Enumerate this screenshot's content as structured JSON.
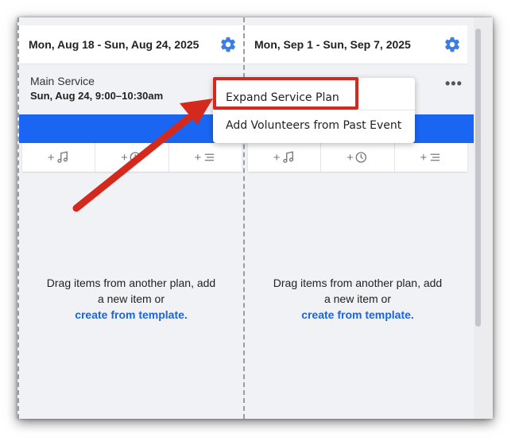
{
  "weeks": [
    {
      "header": "Mon, Aug 18 - Sun, Aug 24, 2025",
      "plan": {
        "name": "Main Service",
        "time": "Sun, Aug 24, 9:00–10:30am"
      },
      "empty": {
        "line1": "Drag items from another plan, add",
        "line2": "a new item or",
        "link": "create from template."
      }
    },
    {
      "header": "Mon, Sep 1 - Sun, Sep 7, 2025",
      "empty": {
        "line1": "Drag items from another plan, add",
        "line2": "a new item or",
        "link": "create from template."
      }
    }
  ],
  "toolbar": {
    "plus": "+"
  },
  "menu": {
    "items": [
      "Expand Service Plan",
      "Add Volunteers from Past Event"
    ]
  },
  "more_label": "•••",
  "colors": {
    "accent": "#1a66f2",
    "highlight": "#d42a1e",
    "link": "#1d63db",
    "gear": "#3b7de0"
  },
  "icons": [
    "gear-icon",
    "music-note-icon",
    "clock-edit-icon",
    "list-icon",
    "more-icon"
  ]
}
